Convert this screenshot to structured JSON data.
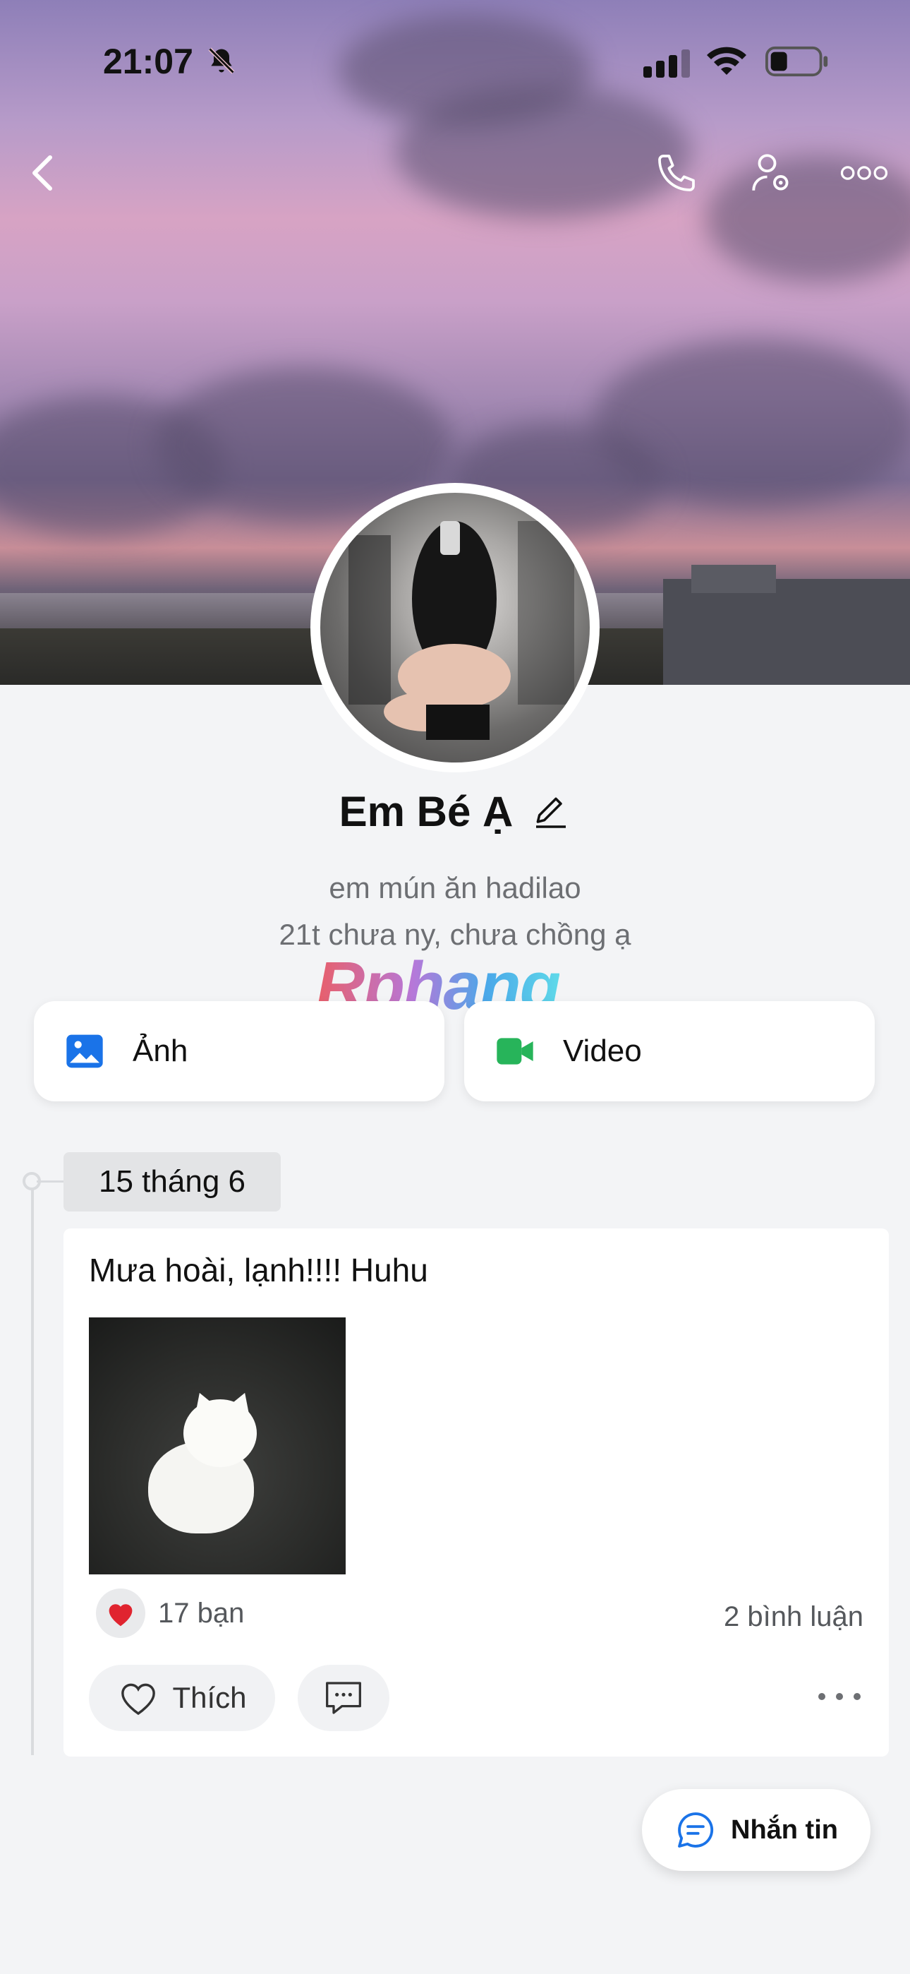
{
  "status_bar": {
    "time": "21:07"
  },
  "profile": {
    "name": "Em Bé Ạ",
    "bio_line1": "em mún ăn hadilao",
    "bio_line2": "21t chưa ny, chưa chồng ạ"
  },
  "watermark": "Rphang",
  "media_cards": [
    {
      "label": "Ảnh",
      "icon": "photo-icon",
      "color": "#1a73e8"
    },
    {
      "label": "Video",
      "icon": "video-icon",
      "color": "#27b45a"
    }
  ],
  "post": {
    "date": "15 tháng 6",
    "text": "Mưa hoài, lạnh!!!! Huhu",
    "reactions": "17 bạn",
    "comments": "2 bình luận",
    "like_label": "Thích"
  },
  "fab": {
    "label": "Nhắn tin",
    "color": "#1a73e8"
  }
}
